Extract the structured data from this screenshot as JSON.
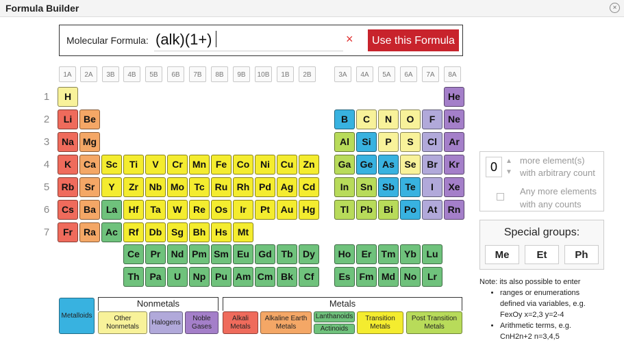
{
  "window": {
    "title": "Formula Builder"
  },
  "formula": {
    "label": "Molecular Formula:",
    "value": "(alk)(1+)",
    "clear_glyph": "×",
    "use_button": "Use this Formula"
  },
  "group_labels": [
    "1A",
    "2A",
    "3B",
    "4B",
    "5B",
    "6B",
    "7B",
    "8B",
    "9B",
    "10B",
    "1B",
    "2B",
    "3A",
    "4A",
    "5A",
    "6A",
    "7A",
    "8A"
  ],
  "periods": [
    "1",
    "2",
    "3",
    "4",
    "5",
    "6",
    "7"
  ],
  "elements": [
    {
      "s": "H",
      "c": "other"
    },
    {
      "s": "He",
      "c": "noble"
    },
    {
      "s": "Li",
      "c": "alkali"
    },
    {
      "s": "Be",
      "c": "alkaline"
    },
    {
      "s": "B",
      "c": "metalloid"
    },
    {
      "s": "C",
      "c": "other"
    },
    {
      "s": "N",
      "c": "other"
    },
    {
      "s": "O",
      "c": "other"
    },
    {
      "s": "F",
      "c": "halogen"
    },
    {
      "s": "Ne",
      "c": "noble"
    },
    {
      "s": "Na",
      "c": "alkali"
    },
    {
      "s": "Mg",
      "c": "alkaline"
    },
    {
      "s": "Al",
      "c": "post"
    },
    {
      "s": "Si",
      "c": "metalloid"
    },
    {
      "s": "P",
      "c": "other"
    },
    {
      "s": "S",
      "c": "other"
    },
    {
      "s": "Cl",
      "c": "halogen"
    },
    {
      "s": "Ar",
      "c": "noble"
    },
    {
      "s": "K",
      "c": "alkali"
    },
    {
      "s": "Ca",
      "c": "alkaline"
    },
    {
      "s": "Sc",
      "c": "transition"
    },
    {
      "s": "Ti",
      "c": "transition"
    },
    {
      "s": "V",
      "c": "transition"
    },
    {
      "s": "Cr",
      "c": "transition"
    },
    {
      "s": "Mn",
      "c": "transition"
    },
    {
      "s": "Fe",
      "c": "transition"
    },
    {
      "s": "Co",
      "c": "transition"
    },
    {
      "s": "Ni",
      "c": "transition"
    },
    {
      "s": "Cu",
      "c": "transition"
    },
    {
      "s": "Zn",
      "c": "transition"
    },
    {
      "s": "Ga",
      "c": "post"
    },
    {
      "s": "Ge",
      "c": "metalloid"
    },
    {
      "s": "As",
      "c": "metalloid"
    },
    {
      "s": "Se",
      "c": "other"
    },
    {
      "s": "Br",
      "c": "halogen"
    },
    {
      "s": "Kr",
      "c": "noble"
    },
    {
      "s": "Rb",
      "c": "alkali"
    },
    {
      "s": "Sr",
      "c": "alkaline"
    },
    {
      "s": "Y",
      "c": "transition"
    },
    {
      "s": "Zr",
      "c": "transition"
    },
    {
      "s": "Nb",
      "c": "transition"
    },
    {
      "s": "Mo",
      "c": "transition"
    },
    {
      "s": "Tc",
      "c": "transition"
    },
    {
      "s": "Ru",
      "c": "transition"
    },
    {
      "s": "Rh",
      "c": "transition"
    },
    {
      "s": "Pd",
      "c": "transition"
    },
    {
      "s": "Ag",
      "c": "transition"
    },
    {
      "s": "Cd",
      "c": "transition"
    },
    {
      "s": "In",
      "c": "post"
    },
    {
      "s": "Sn",
      "c": "post"
    },
    {
      "s": "Sb",
      "c": "metalloid"
    },
    {
      "s": "Te",
      "c": "metalloid"
    },
    {
      "s": "I",
      "c": "halogen"
    },
    {
      "s": "Xe",
      "c": "noble"
    },
    {
      "s": "Cs",
      "c": "alkali"
    },
    {
      "s": "Ba",
      "c": "alkaline"
    },
    {
      "s": "La",
      "c": "lanth"
    },
    {
      "s": "Hf",
      "c": "transition"
    },
    {
      "s": "Ta",
      "c": "transition"
    },
    {
      "s": "W",
      "c": "transition"
    },
    {
      "s": "Re",
      "c": "transition"
    },
    {
      "s": "Os",
      "c": "transition"
    },
    {
      "s": "Ir",
      "c": "transition"
    },
    {
      "s": "Pt",
      "c": "transition"
    },
    {
      "s": "Au",
      "c": "transition"
    },
    {
      "s": "Hg",
      "c": "transition"
    },
    {
      "s": "Tl",
      "c": "post"
    },
    {
      "s": "Pb",
      "c": "post"
    },
    {
      "s": "Bi",
      "c": "post"
    },
    {
      "s": "Po",
      "c": "metalloid"
    },
    {
      "s": "At",
      "c": "halogen"
    },
    {
      "s": "Rn",
      "c": "noble"
    },
    {
      "s": "Fr",
      "c": "alkali"
    },
    {
      "s": "Ra",
      "c": "alkaline"
    },
    {
      "s": "Ac",
      "c": "lanth"
    },
    {
      "s": "Rf",
      "c": "transition"
    },
    {
      "s": "Db",
      "c": "transition"
    },
    {
      "s": "Sg",
      "c": "transition"
    },
    {
      "s": "Bh",
      "c": "transition"
    },
    {
      "s": "Hs",
      "c": "transition"
    },
    {
      "s": "Mt",
      "c": "transition"
    },
    {
      "s": "Ce",
      "c": "lanth"
    },
    {
      "s": "Pr",
      "c": "lanth"
    },
    {
      "s": "Nd",
      "c": "lanth"
    },
    {
      "s": "Pm",
      "c": "lanth"
    },
    {
      "s": "Sm",
      "c": "lanth"
    },
    {
      "s": "Eu",
      "c": "lanth"
    },
    {
      "s": "Gd",
      "c": "lanth"
    },
    {
      "s": "Tb",
      "c": "lanth"
    },
    {
      "s": "Dy",
      "c": "lanth"
    },
    {
      "s": "Ho",
      "c": "lanth"
    },
    {
      "s": "Er",
      "c": "lanth"
    },
    {
      "s": "Tm",
      "c": "lanth"
    },
    {
      "s": "Yb",
      "c": "lanth"
    },
    {
      "s": "Lu",
      "c": "lanth"
    },
    {
      "s": "Th",
      "c": "lanth"
    },
    {
      "s": "Pa",
      "c": "lanth"
    },
    {
      "s": "U",
      "c": "lanth"
    },
    {
      "s": "Np",
      "c": "lanth"
    },
    {
      "s": "Pu",
      "c": "lanth"
    },
    {
      "s": "Am",
      "c": "lanth"
    },
    {
      "s": "Cm",
      "c": "lanth"
    },
    {
      "s": "Bk",
      "c": "lanth"
    },
    {
      "s": "Cf",
      "c": "lanth"
    },
    {
      "s": "Es",
      "c": "lanth"
    },
    {
      "s": "Fm",
      "c": "lanth"
    },
    {
      "s": "Md",
      "c": "lanth"
    },
    {
      "s": "No",
      "c": "lanth"
    },
    {
      "s": "Lr",
      "c": "lanth"
    }
  ],
  "count_box": {
    "value": "0",
    "more_line1": "more element(s)",
    "more_line2": "with arbitrary count",
    "any_line1": "Any more elements",
    "any_line2": "with any counts"
  },
  "special_groups": {
    "title": "Special groups:",
    "buttons": [
      "Me",
      "Et",
      "Ph"
    ]
  },
  "note": {
    "intro": "Note: its also possible to enter",
    "bullet1_a": "ranges or enumerations",
    "bullet1_b": "defined via variables, e.g.",
    "bullet1_c": "FexOy x=2,3 y=2-4",
    "bullet2_a": "Arithmetic terms, e.g.",
    "bullet2_b": "CnH2n+2 n=3,4,5"
  },
  "legend": {
    "metalloids": "Metalloids",
    "nonmetals_head": "Nonmetals",
    "other_a": "Other",
    "other_b": "Nonmetals",
    "halogens": "Halogens",
    "noble_a": "Noble",
    "noble_b": "Gases",
    "metals_head": "Metals",
    "alkali_a": "Alkali",
    "alkali_b": "Metals",
    "alkaline_a": "Alkaline Earth",
    "alkaline_b": "Metals",
    "lanthanoids": "Lanthanoids",
    "actinoids": "Actinoids",
    "transition_a": "Transition",
    "transition_b": "Metals",
    "post_a": "Post Transition",
    "post_b": "Metals"
  },
  "colors": {
    "alkali": "#ef6b5c",
    "alkaline": "#f4a766",
    "transition": "#f4ec2f",
    "post": "#b8db5a",
    "metalloid": "#38b2e0",
    "other": "#f8f29a",
    "halogen": "#b1a9da",
    "noble": "#a47fc9",
    "lanth": "#6fc27c",
    "button_red": "#c8232c"
  }
}
